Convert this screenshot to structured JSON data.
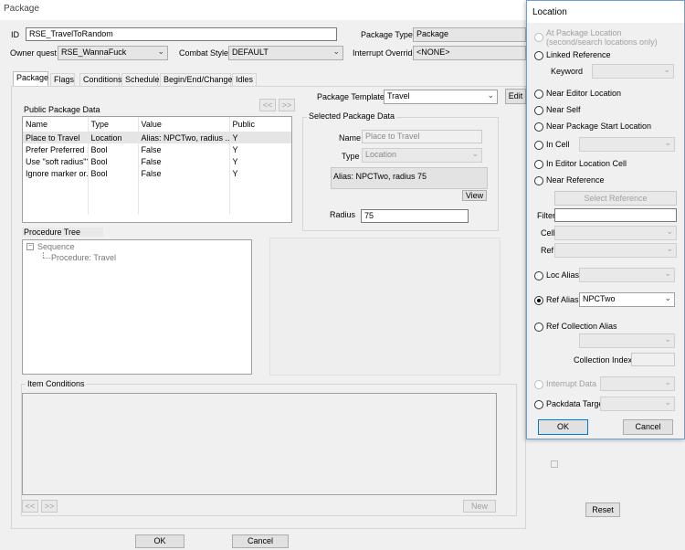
{
  "window": {
    "title": "Package"
  },
  "form": {
    "id_label": "ID",
    "id_value": "RSE_TravelToRandom",
    "owner_label": "Owner quest",
    "owner_value": "RSE_WannaFuck",
    "combat_label": "Combat Style",
    "combat_value": "DEFAULT",
    "ptype_label": "Package Type",
    "ptype_value": "Package",
    "interrupt_label": "Interrupt Override",
    "interrupt_value": "<NONE>"
  },
  "tabs": [
    {
      "label": "Package"
    },
    {
      "label": "Flags"
    },
    {
      "label": "Conditions"
    },
    {
      "label": "Schedule"
    },
    {
      "label": "Begin/End/Change"
    },
    {
      "label": "Idles"
    }
  ],
  "public_data": {
    "title": "Public Package Data",
    "prev": "<<",
    "next": ">>",
    "columns": [
      "Name",
      "Type",
      "Value",
      "Public"
    ],
    "rows": [
      {
        "name": "Place to Travel",
        "type": "Location",
        "value": "Alias: NPCTwo, radius ...",
        "public": "Y"
      },
      {
        "name": "Prefer Preferred ...",
        "type": "Bool",
        "value": "False",
        "public": "Y"
      },
      {
        "name": "Use \"soft radius\"?",
        "type": "Bool",
        "value": "False",
        "public": "Y"
      },
      {
        "name": "Ignore marker or...",
        "type": "Bool",
        "value": "False",
        "public": "Y"
      }
    ]
  },
  "template": {
    "label": "Package Template",
    "value": "Travel",
    "edit": "Edit"
  },
  "selected": {
    "title": "Selected Package Data",
    "name_label": "Name",
    "name_value": "Place to Travel",
    "type_label": "Type",
    "type_value": "Location",
    "desc": "Alias: NPCTwo, radius 75",
    "view": "View",
    "radius_label": "Radius",
    "radius_value": "75"
  },
  "procedure": {
    "title": "Procedure Tree",
    "root": "Sequence",
    "child": "Procedure: Travel"
  },
  "conditions": {
    "title": "Item Conditions",
    "prev": "<<",
    "next": ">>",
    "new": "New"
  },
  "bottom": {
    "ok": "OK",
    "cancel": "Cancel",
    "reset": "Reset"
  },
  "location_dialog": {
    "title": "Location",
    "at_pkg": "At Package Location",
    "at_pkg_sub": "(second/search locations only)",
    "linked_ref": "Linked Reference",
    "keyword": "Keyword",
    "near_editor": "Near Editor Location",
    "near_self": "Near Self",
    "near_start": "Near Package Start Location",
    "in_cell": "In Cell",
    "in_editor_cell": "In Editor Location Cell",
    "near_ref": "Near Reference",
    "select_ref": "Select Reference",
    "filter": "Filter",
    "cell": "Cell",
    "ref": "Ref",
    "loc_alias": "Loc Alias",
    "ref_alias": "Ref Alias",
    "ref_alias_value": "NPCTwo",
    "ref_coll_alias": "Ref Collection Alias",
    "coll_index": "Collection Index",
    "interrupt_data": "Interrupt Data",
    "packdata_target": "Packdata Target",
    "ok": "OK",
    "cancel": "Cancel"
  }
}
